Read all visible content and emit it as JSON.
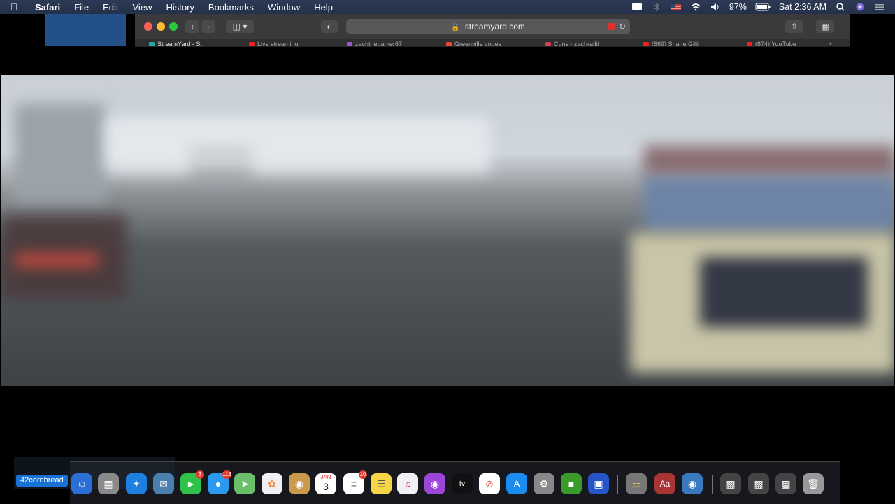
{
  "menubar": {
    "apple_icon": "apple-icon",
    "app_name": "Safari",
    "menus": [
      "File",
      "Edit",
      "View",
      "History",
      "Bookmarks",
      "Window",
      "Help"
    ],
    "battery": "97%",
    "clock": "Sat 2:36 AM"
  },
  "browser": {
    "url": "streamyard.com",
    "tabs": [
      "StreamYard - St",
      "Live streaming",
      "zachthegamer67",
      "Greenville codes",
      "Cons - zachratlif",
      "(869) Shane Gilli",
      "(874) YouTube"
    ]
  },
  "stream": {
    "name_badge": "42cornbread"
  },
  "dock": {
    "messages_badge": "3",
    "chat_badge": "118",
    "calendar_month": "JAN",
    "calendar_day": "3",
    "reminders_badge": "10",
    "tv_label": "tv"
  },
  "colors": {
    "menubar": "#25314a",
    "accent": "#1872d6",
    "badge": "#e53b30"
  }
}
